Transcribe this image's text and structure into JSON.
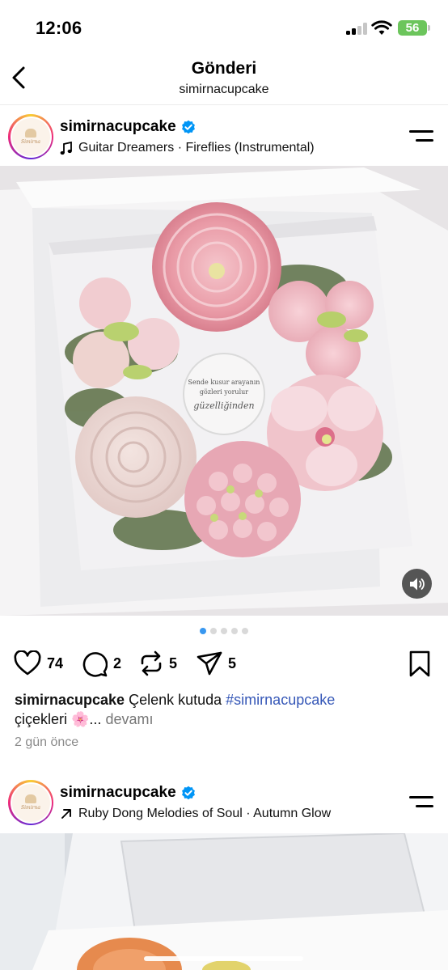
{
  "status_bar": {
    "time": "12:06",
    "battery": "56",
    "signal_bars_filled": 2,
    "signal_bars_total": 4
  },
  "header": {
    "title": "Gönderi",
    "subtitle": "simirnacupcake",
    "back_icon": "chevron-left-icon"
  },
  "post": {
    "username": "simirnacupcake",
    "verified": true,
    "music": "Guitar Dreamers · Fireflies (Instrumental)",
    "music_icon": "music-note-icon",
    "image_message": {
      "line1": "Sende kusur arayanın",
      "line2": "gözleri yorulur",
      "line3": "güzelliğinden"
    },
    "carousel": {
      "count": 5,
      "active_index": 0
    },
    "likes": "74",
    "comments": "2",
    "reposts": "5",
    "shares": "5",
    "caption_username": "simirnacupcake",
    "caption_text": "Çelenk kutuda ",
    "caption_hashtag": "#simirnacupcake",
    "caption_line2": "çiçekleri 🌸...",
    "caption_more": "devamı",
    "time_ago": "2 gün önce"
  },
  "next_post": {
    "username": "simirnacupcake",
    "verified": true,
    "music": "Ruby Dong Melodies of Soul · Autumn Glow",
    "music_icon": "arrow-up-right-icon"
  },
  "colors": {
    "accent_blue": "#3897f0",
    "hashtag": "#3557b7",
    "verified_blue": "#0095f6",
    "battery_green": "#6cc55c"
  }
}
